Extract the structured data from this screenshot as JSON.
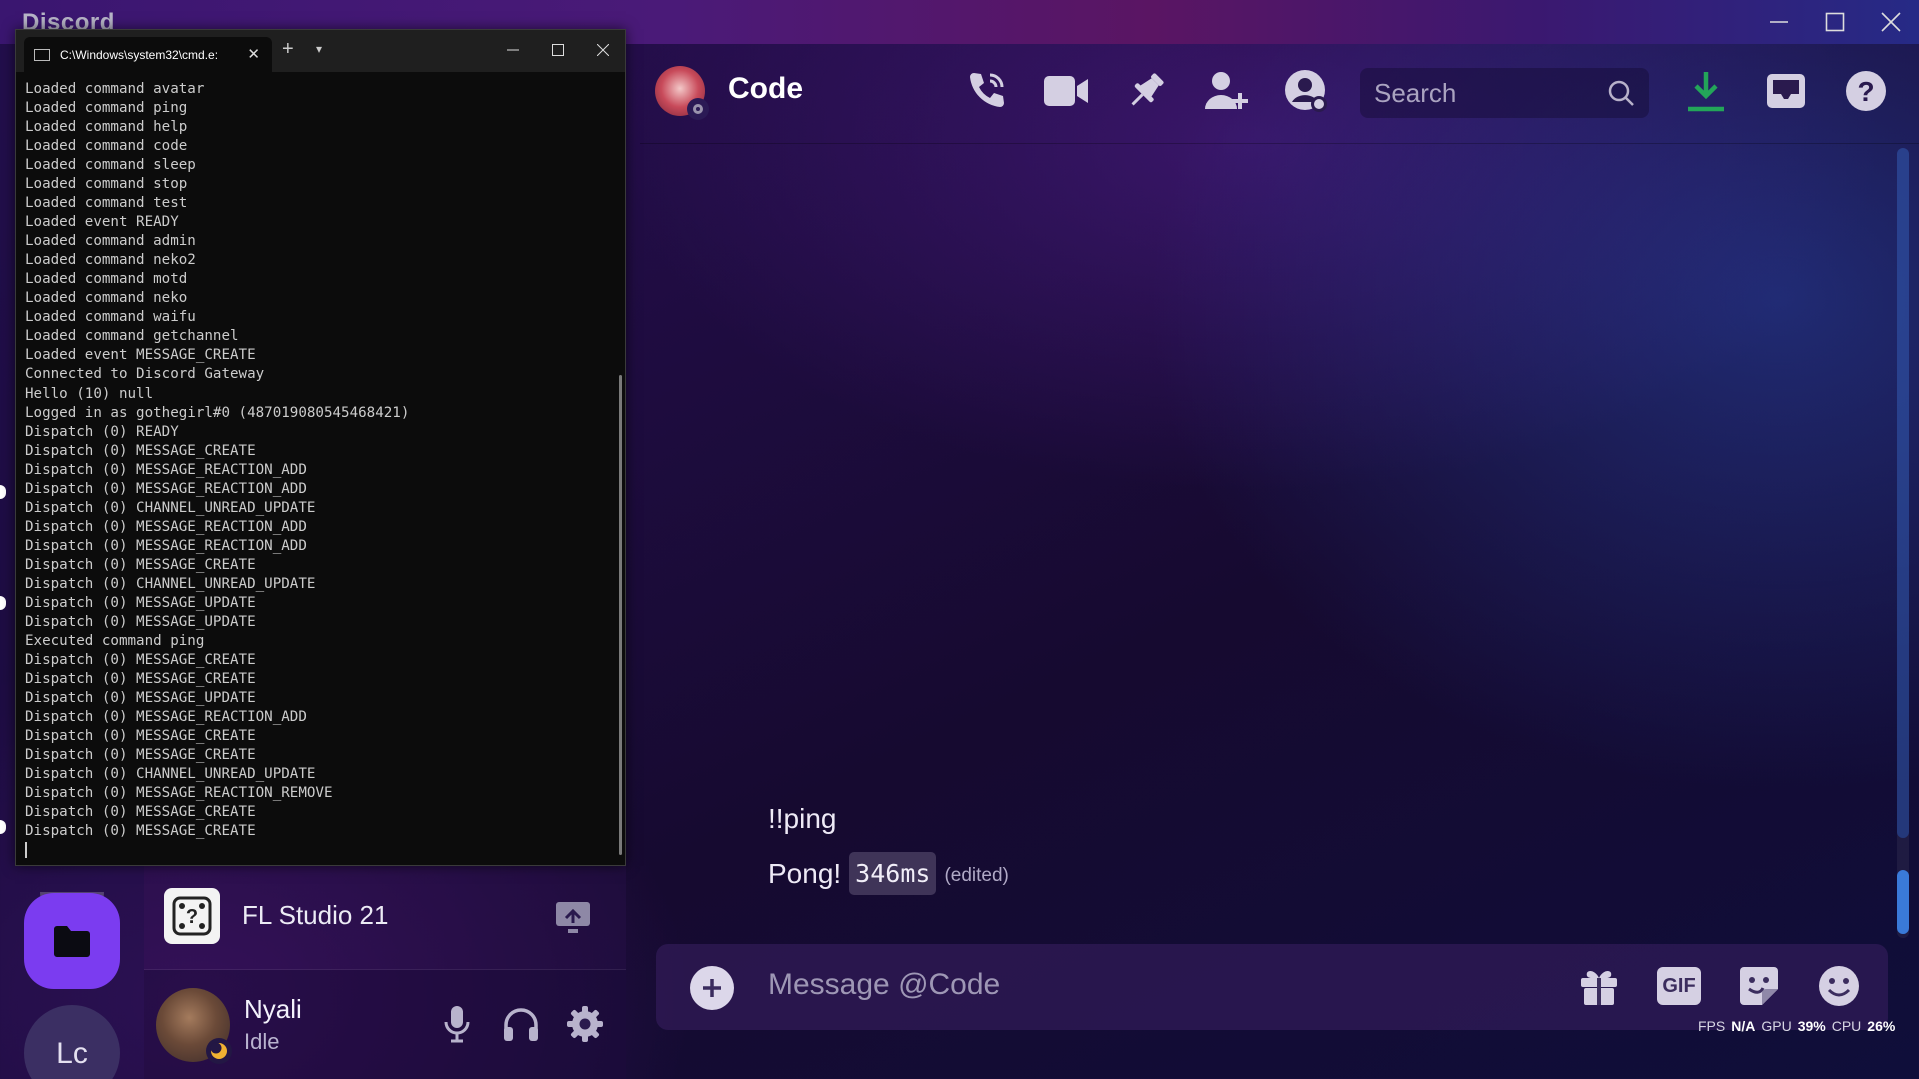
{
  "app": {
    "name": "Discord"
  },
  "window_controls": [
    "minimize",
    "maximize",
    "close"
  ],
  "terminal": {
    "tab_title": "C:\\Windows\\system32\\cmd.e:",
    "lines": [
      "Loaded command avatar",
      "Loaded command ping",
      "Loaded command help",
      "Loaded command code",
      "Loaded command sleep",
      "Loaded command stop",
      "Loaded command test",
      "Loaded event READY",
      "Loaded command admin",
      "Loaded command neko2",
      "Loaded command motd",
      "Loaded command neko",
      "Loaded command waifu",
      "Loaded command getchannel",
      "Loaded event MESSAGE_CREATE",
      "Connected to Discord Gateway",
      "Hello (10) null",
      "Logged in as gothegirl#0 (487019080545468421)",
      "Dispatch (0) READY",
      "Dispatch (0) MESSAGE_CREATE",
      "Dispatch (0) MESSAGE_REACTION_ADD",
      "Dispatch (0) MESSAGE_REACTION_ADD",
      "Dispatch (0) CHANNEL_UNREAD_UPDATE",
      "Dispatch (0) MESSAGE_REACTION_ADD",
      "Dispatch (0) MESSAGE_REACTION_ADD",
      "Dispatch (0) MESSAGE_CREATE",
      "Dispatch (0) CHANNEL_UNREAD_UPDATE",
      "Dispatch (0) MESSAGE_UPDATE",
      "Dispatch (0) MESSAGE_UPDATE",
      "Executed command ping",
      "Dispatch (0) MESSAGE_CREATE",
      "Dispatch (0) MESSAGE_CREATE",
      "Dispatch (0) MESSAGE_UPDATE",
      "Dispatch (0) MESSAGE_REACTION_ADD",
      "Dispatch (0) MESSAGE_CREATE",
      "Dispatch (0) MESSAGE_CREATE",
      "Dispatch (0) CHANNEL_UNREAD_UPDATE",
      "Dispatch (0) MESSAGE_REACTION_REMOVE",
      "Dispatch (0) MESSAGE_CREATE",
      "Dispatch (0) MESSAGE_CREATE"
    ]
  },
  "guild_rail": {
    "folder_icon": "folder-icon",
    "lc_label": "Lc"
  },
  "activity": {
    "game_name": "FL Studio 21",
    "game_icon": "unknown-game-icon",
    "stream_icon": "stream-screen-icon"
  },
  "user": {
    "name": "Nyali",
    "status": "Idle",
    "status_color": "#f0b232"
  },
  "chat": {
    "dm_name": "Code",
    "search_placeholder": "Search",
    "header_icons": [
      "phone-call-icon",
      "video-call-icon",
      "pin-icon",
      "add-friend-icon",
      "profile-icon"
    ],
    "right_icons": [
      "download-icon",
      "inbox-icon",
      "help-icon"
    ],
    "download_color": "#23a559",
    "messages": [
      {
        "text": "!!ping"
      },
      {
        "text": "Pong!",
        "code": "346ms",
        "edited": "(edited)"
      }
    ],
    "composer_placeholder": "Message @Code",
    "composer_icons": [
      "gift-icon",
      "gif-icon",
      "sticker-icon",
      "emoji-icon"
    ],
    "gif_label": "GIF"
  },
  "perf": {
    "fps_label": "FPS",
    "fps_value": "N/A",
    "gpu_label": "GPU",
    "gpu_value": "39%",
    "cpu_label": "CPU",
    "cpu_value": "26%"
  }
}
